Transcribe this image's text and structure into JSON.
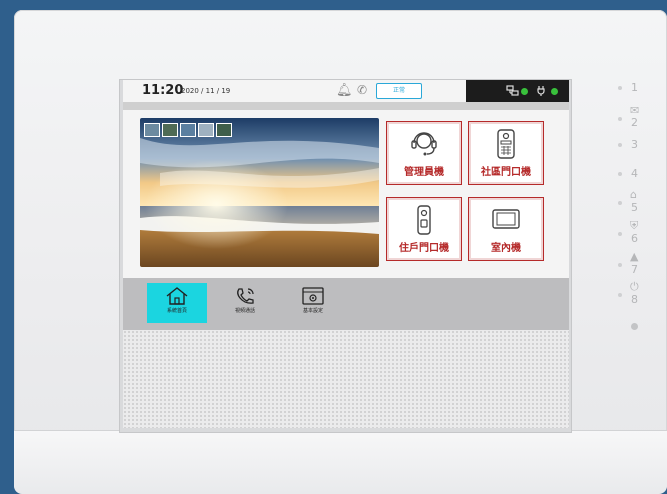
{
  "status": {
    "time": "11:20",
    "date": "2020 / 11 / 19",
    "mode_label": "正常"
  },
  "tiles": [
    {
      "label": "管理員機",
      "icon": "headset-icon"
    },
    {
      "label": "社區門口機",
      "icon": "door-station-icon"
    },
    {
      "label": "住戶門口機",
      "icon": "doorbell-icon"
    },
    {
      "label": "室內機",
      "icon": "monitor-icon"
    }
  ],
  "nav": [
    {
      "label": "系統首頁",
      "icon": "home-icon",
      "active": true
    },
    {
      "label": "視頻通話",
      "icon": "phone-icon",
      "active": false
    },
    {
      "label": "基本設定",
      "icon": "settings-icon",
      "active": false
    }
  ],
  "side_keys": [
    "1",
    "2",
    "3",
    "4",
    "5",
    "6",
    "7",
    "8"
  ],
  "colors": {
    "accent": "#1bd5e0",
    "tile_red": "#b52a2a",
    "ok_green": "#39c13c"
  }
}
